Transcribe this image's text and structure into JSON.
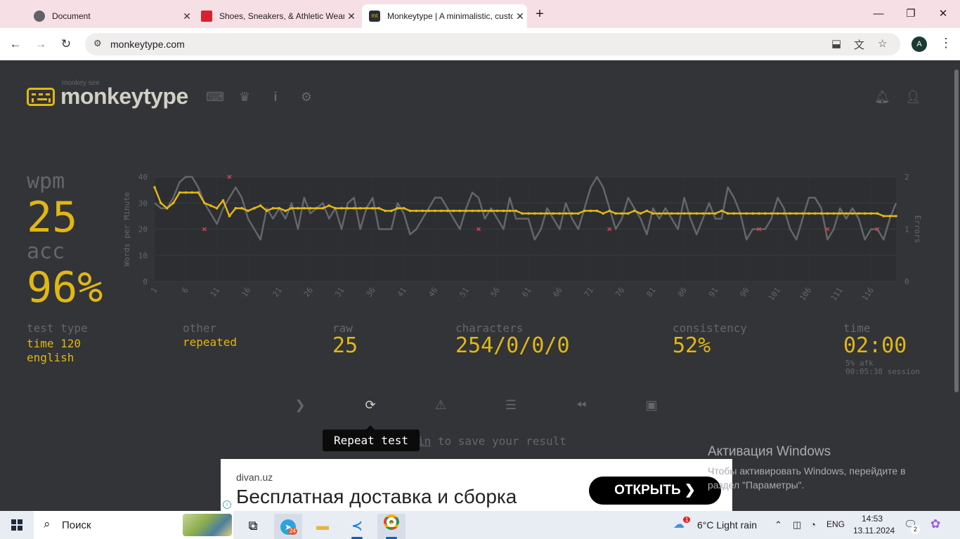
{
  "browser": {
    "tabs": [
      {
        "title": "Document",
        "active": false
      },
      {
        "title": "Shoes, Sneakers, & Athletic Wear",
        "active": false
      },
      {
        "title": "Monkeytype | A minimalistic, customizable typing test",
        "active": true
      }
    ],
    "url": "monkeytype.com",
    "profile_initial": "A"
  },
  "header": {
    "logo_subtitle": "monkey see",
    "logo_text": "monkeytype",
    "nav_icons": [
      "keyboard-icon",
      "crown-icon",
      "info-icon",
      "gear-icon"
    ],
    "right_icons": [
      "bell-icon",
      "user-icon"
    ]
  },
  "result": {
    "wpm_label": "wpm",
    "wpm_value": "25",
    "acc_label": "acc",
    "acc_value": "96%",
    "test_type_label": "test type",
    "test_type_line1": "time 120",
    "test_type_line2": "english",
    "other_label": "other",
    "other_value": "repeated",
    "raw_label": "raw",
    "raw_value": "25",
    "characters_label": "characters",
    "characters_value": "254/0/0/0",
    "consistency_label": "consistency",
    "consistency_value": "52%",
    "time_label": "time",
    "time_value": "02:00",
    "afk": "5% afk",
    "session": "00:05:38 session"
  },
  "actions": {
    "icons": [
      "next-test-icon",
      "repeat-test-icon",
      "report-icon",
      "words-history-icon",
      "replay-icon",
      "screenshot-icon"
    ],
    "tooltip": "Repeat test",
    "save_prefix": "in",
    "save_suffix": " to save your result"
  },
  "ad": {
    "domain": "divan.uz",
    "headline": "Бесплатная доставка и сборка",
    "cta": "ОТКРЫТЬ"
  },
  "watermark": {
    "title": "Активация Windows",
    "text": "Чтобы активировать Windows, перейдите в раздел \"Параметры\"."
  },
  "taskbar": {
    "search": "Поиск",
    "telegram_badge": "24",
    "weather": "6°C  Light rain",
    "weather_badge": "1",
    "lang": "ENG",
    "time": "14:53",
    "date": "13.11.2024",
    "notif_count": "2"
  },
  "colors": {
    "accent": "#e2b714",
    "bg": "#323437",
    "sub": "#646669",
    "error": "#ca4754"
  },
  "chart_data": {
    "type": "line",
    "ylabel": "Words per Minute",
    "y2label": "Errors",
    "ylim": [
      0,
      40
    ],
    "y2lim": [
      0,
      2
    ],
    "yticks": [
      0,
      10,
      20,
      30,
      40
    ],
    "y2ticks": [
      0,
      1,
      2
    ],
    "xticks": [
      1,
      6,
      11,
      16,
      21,
      26,
      31,
      36,
      41,
      46,
      51,
      56,
      61,
      66,
      71,
      76,
      81,
      86,
      91,
      96,
      101,
      106,
      111,
      116
    ],
    "xlim": [
      1,
      120
    ],
    "series": [
      {
        "name": "wpm",
        "color": "#e2b714",
        "values": [
          36,
          30,
          28,
          30,
          34,
          34,
          34,
          34,
          30,
          29,
          28,
          31,
          25,
          28,
          28,
          27,
          28,
          29,
          27,
          28,
          28,
          27,
          28,
          28,
          28,
          28,
          28,
          28,
          29,
          28,
          28,
          28,
          28,
          28,
          28,
          28,
          28,
          27,
          27,
          28,
          28,
          27,
          27,
          27,
          27,
          27,
          27,
          27,
          27,
          27,
          27,
          27,
          27,
          27,
          27,
          27,
          27,
          27,
          27,
          26,
          26,
          26,
          26,
          26,
          26,
          26,
          26,
          26,
          26,
          27,
          27,
          27,
          26,
          27,
          26,
          26,
          26,
          27,
          26,
          27,
          26,
          26,
          26,
          26,
          26,
          26,
          26,
          26,
          26,
          26,
          26,
          27,
          26,
          26,
          26,
          26,
          26,
          26,
          26,
          26,
          26,
          26,
          26,
          26,
          26,
          26,
          26,
          26,
          26,
          26,
          26,
          26,
          26,
          26,
          26,
          26,
          26,
          25,
          25,
          25
        ]
      },
      {
        "name": "raw",
        "color": "#646669",
        "values": [
          30,
          28,
          28,
          32,
          38,
          40,
          40,
          36,
          30,
          26,
          22,
          28,
          32,
          36,
          32,
          24,
          20,
          16,
          28,
          24,
          28,
          24,
          30,
          20,
          32,
          26,
          28,
          30,
          24,
          28,
          20,
          30,
          32,
          20,
          28,
          32,
          20,
          20,
          20,
          30,
          26,
          18,
          20,
          24,
          28,
          32,
          32,
          28,
          24,
          20,
          28,
          34,
          32,
          24,
          28,
          24,
          20,
          32,
          24,
          24,
          24,
          16,
          20,
          28,
          24,
          20,
          30,
          24,
          20,
          28,
          36,
          40,
          36,
          28,
          20,
          24,
          32,
          28,
          24,
          18,
          28,
          24,
          28,
          24,
          20,
          32,
          24,
          18,
          24,
          30,
          24,
          24,
          36,
          32,
          26,
          16,
          20,
          20,
          20,
          24,
          32,
          28,
          20,
          16,
          24,
          32,
          32,
          28,
          16,
          20,
          28,
          24,
          28,
          24,
          16,
          20,
          20,
          16,
          24,
          30
        ]
      },
      {
        "name": "errors",
        "color": "#ca4754",
        "type": "scatter",
        "points": [
          [
            9,
            1
          ],
          [
            13,
            2
          ],
          [
            53,
            1
          ],
          [
            74,
            1
          ],
          [
            98,
            1
          ],
          [
            109,
            1
          ],
          [
            117,
            1
          ]
        ]
      }
    ]
  }
}
